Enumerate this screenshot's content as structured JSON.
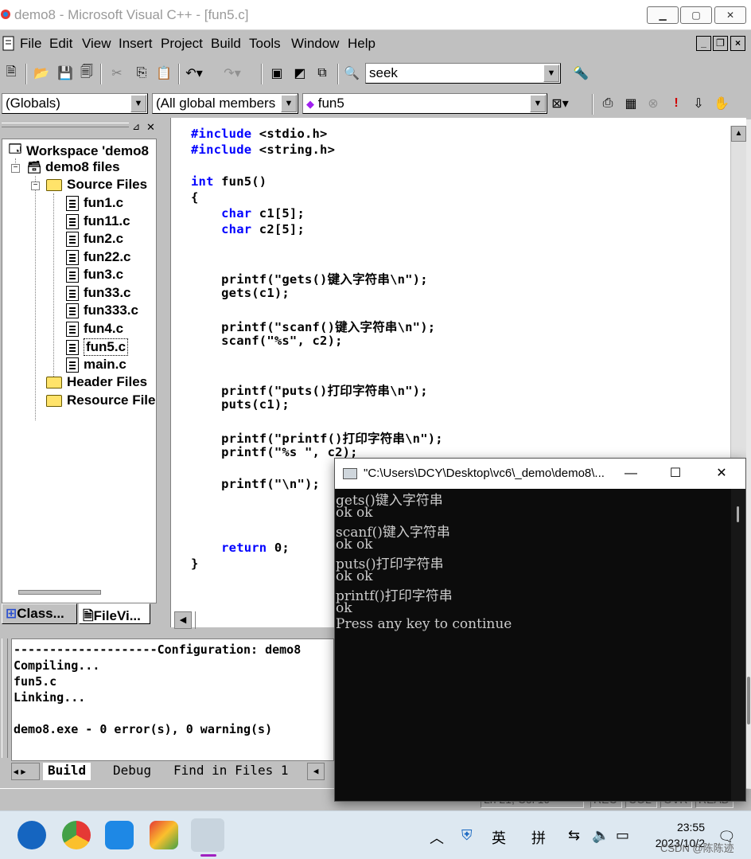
{
  "window": {
    "title": "demo8 - Microsoft Visual C++ - [fun5.c]",
    "icon": "vc-app-icon",
    "controls": [
      "minimize",
      "restore",
      "close"
    ]
  },
  "menu": {
    "items": [
      "File",
      "Edit",
      "View",
      "Insert",
      "Project",
      "Build",
      "Tools",
      "Window",
      "Help"
    ]
  },
  "toolbar": {
    "find_combo_value": "seek",
    "scope_combo_value": "(Globals)",
    "members_combo_value": "(All global members",
    "function_combo_value": "fun5"
  },
  "workspace": {
    "root": "Workspace 'demo8",
    "project": "demo8 files",
    "source_folder": "Source Files",
    "files": [
      "fun1.c",
      "fun11.c",
      "fun2.c",
      "fun22.c",
      "fun3.c",
      "fun33.c",
      "fun333.c",
      "fun4.c",
      "fun5.c",
      "main.c"
    ],
    "selected_file": "fun5.c",
    "header_folder": "Header Files",
    "resource_folder": "Resource File",
    "tabs": [
      "Class...",
      "FileVi..."
    ]
  },
  "editor": {
    "lines": [
      {
        "kw": "#include",
        "rest": " <stdio.h>"
      },
      {
        "kw": "#include",
        "rest": " <string.h>"
      },
      {
        "kw": "",
        "rest": ""
      },
      {
        "kw": "int",
        "rest": " fun5()"
      },
      {
        "kw": "",
        "rest": "{"
      },
      {
        "kw": "    char",
        "rest": " c1[5];"
      },
      {
        "kw": "    char",
        "rest": " c2[5];"
      },
      {
        "kw": "",
        "rest": ""
      },
      {
        "kw": "",
        "rest": ""
      },
      {
        "kw": "",
        "rest": "    printf(\"gets()键入字符串\\n\");"
      },
      {
        "kw": "",
        "rest": "    gets(c1);"
      },
      {
        "kw": "",
        "rest": ""
      },
      {
        "kw": "",
        "rest": "    printf(\"scanf()键入字符串\\n\");"
      },
      {
        "kw": "",
        "rest": "    scanf(\"%s\", c2);"
      },
      {
        "kw": "",
        "rest": ""
      },
      {
        "kw": "",
        "rest": ""
      },
      {
        "kw": "",
        "rest": "    printf(\"puts()打印字符串\\n\");"
      },
      {
        "kw": "",
        "rest": "    puts(c1);"
      },
      {
        "kw": "",
        "rest": ""
      },
      {
        "kw": "",
        "rest": "    printf(\"printf()打印字符串\\n\");"
      },
      {
        "kw": "",
        "rest": "    printf(\"%s \", c2);"
      },
      {
        "kw": "",
        "rest": ""
      },
      {
        "kw": "",
        "rest": "    printf(\"\\n\");"
      },
      {
        "kw": "",
        "rest": ""
      },
      {
        "kw": "",
        "rest": ""
      },
      {
        "kw": "",
        "rest": ""
      },
      {
        "kw": "    return",
        "rest": " 0;"
      },
      {
        "kw": "",
        "rest": "}"
      }
    ]
  },
  "output": {
    "lines": [
      "--------------------Configuration: demo8",
      "Compiling...",
      "fun5.c",
      "Linking...",
      "",
      "demo8.exe - 0 error(s), 0 warning(s)"
    ],
    "tabs": [
      "Build",
      "Debug",
      "Find in Files 1"
    ]
  },
  "console": {
    "title": "\"C:\\Users\\DCY\\Desktop\\vc6\\_demo\\demo8\\...",
    "lines": [
      "gets()键入字符串",
      "ok ok",
      "scanf()键入字符串",
      "ok ok",
      "puts()打印字符串",
      "ok ok",
      "printf()打印字符串",
      "ok",
      "Press any key to continue"
    ],
    "controls": [
      "minimize",
      "maximize",
      "close"
    ]
  },
  "statusbar": {
    "position": "Ln 21, Col 19",
    "indicators": [
      "REC",
      "COL",
      "OVR",
      "READ"
    ]
  },
  "taskbar": {
    "tray": [
      "英",
      "拼"
    ],
    "time": "23:55",
    "date": "2023/10/2",
    "watermark": "CSDN @陈陈迹"
  },
  "colors": {
    "keyword": "#0000ff",
    "console_bg": "#0c0c0c",
    "console_text": "#cccccc",
    "chrome": "#c0c0c0"
  }
}
